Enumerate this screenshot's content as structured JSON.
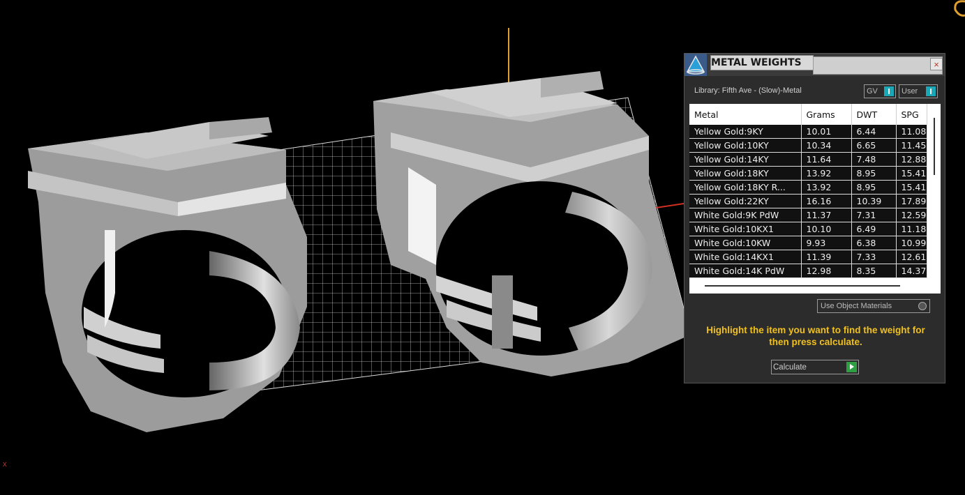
{
  "viewport": {
    "axis_label": "x"
  },
  "panel": {
    "title": "METAL WEIGHTS",
    "close_symbol": "×",
    "library_label": "Library: Fifth Ave - (Slow)-Metal",
    "gv_label": "GV",
    "user_label": "User",
    "columns": [
      "Metal",
      "Grams",
      "DWT",
      "SPG"
    ],
    "rows": [
      [
        "Yellow Gold:9KY",
        "10.01",
        "6.44",
        "11.08"
      ],
      [
        "Yellow Gold:10KY",
        "10.34",
        "6.65",
        "11.45"
      ],
      [
        "Yellow Gold:14KY",
        "11.64",
        "7.48",
        "12.88"
      ],
      [
        "Yellow Gold:18KY",
        "13.92",
        "8.95",
        "15.41"
      ],
      [
        "Yellow Gold:18KY R...",
        "13.92",
        "8.95",
        "15.41"
      ],
      [
        "Yellow Gold:22KY",
        "16.16",
        "10.39",
        "17.89"
      ],
      [
        "White Gold:9K PdW",
        "11.37",
        "7.31",
        "12.59"
      ],
      [
        "White Gold:10KX1",
        "10.10",
        "6.49",
        "11.18"
      ],
      [
        "White Gold:10KW",
        "9.93",
        "6.38",
        "10.99"
      ],
      [
        "White Gold:14KX1",
        "11.39",
        "7.33",
        "12.61"
      ],
      [
        "White Gold:14K PdW",
        "12.98",
        "8.35",
        "14.37"
      ]
    ],
    "use_object_materials_label": "Use Object Materials",
    "instructions": "Highlight the item you want to find the weight for then press calculate.",
    "calculate_label": "Calculate"
  },
  "colors": {
    "instruction_text": "#f0c020",
    "toggle_accent": "#1aa8b8",
    "calculate_accent": "#2ea043"
  }
}
